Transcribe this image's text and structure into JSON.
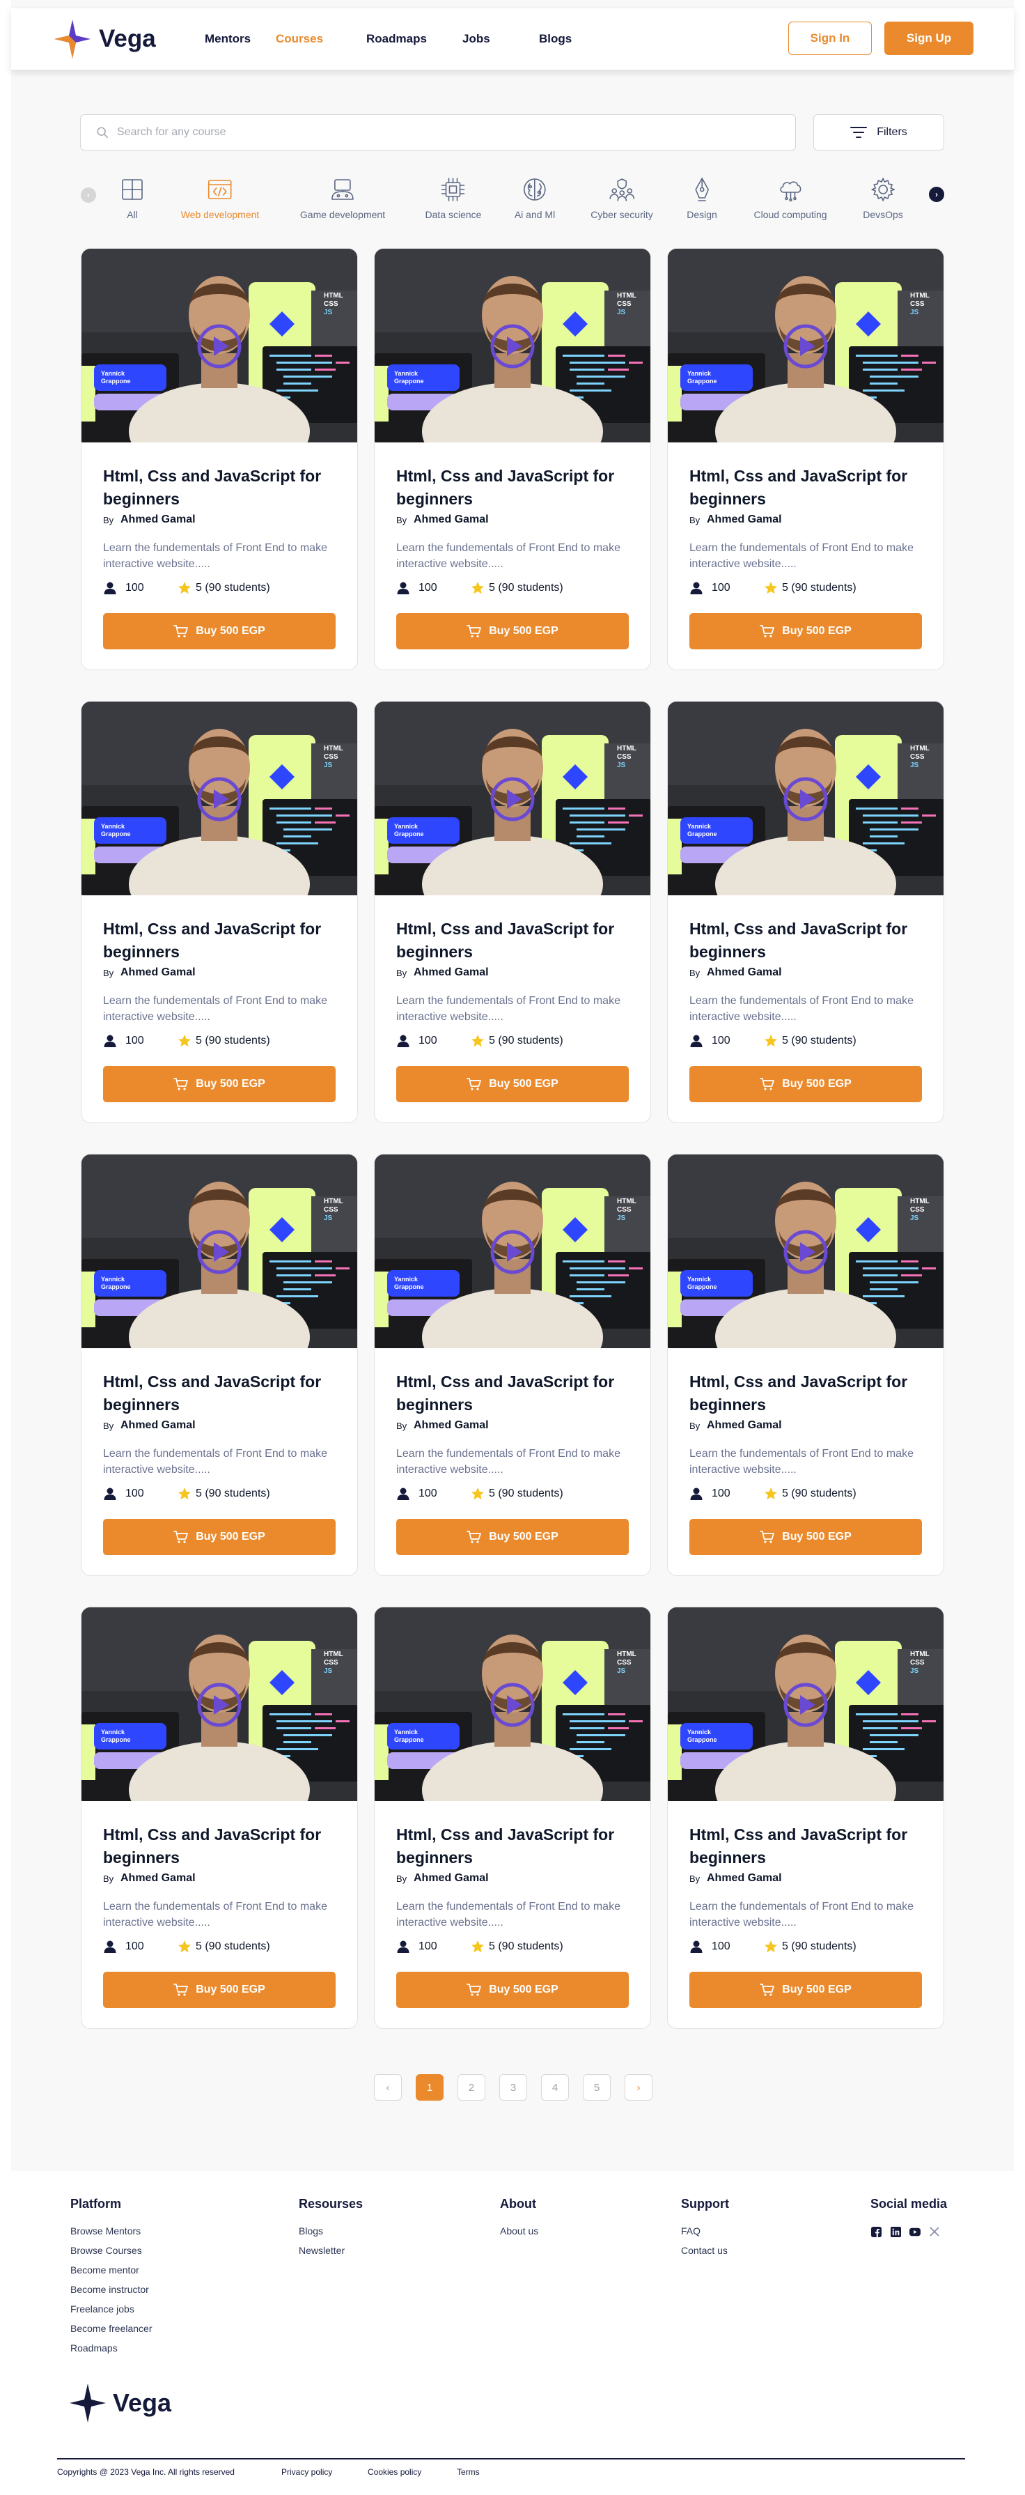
{
  "brand": {
    "name": "Vega",
    "colors": {
      "accent": "#ea8a2c",
      "navy": "#15193a",
      "purple": "#5b3cc4"
    }
  },
  "nav": {
    "links": [
      {
        "label": "Mentors",
        "active": false
      },
      {
        "label": "Courses",
        "active": true
      },
      {
        "label": "Roadmaps",
        "active": false
      },
      {
        "label": "Jobs",
        "active": false
      },
      {
        "label": "Blogs",
        "active": false
      }
    ],
    "signin_label": "Sign In",
    "signup_label": "Sign Up"
  },
  "search": {
    "placeholder": "Search for any course",
    "filters_label": "Filters"
  },
  "categories": [
    {
      "label": "All",
      "icon": "grid-icon",
      "active": false
    },
    {
      "label": "Web development",
      "icon": "browser-code-icon",
      "active": true
    },
    {
      "label": "Game development",
      "icon": "gamepad-icon",
      "active": false
    },
    {
      "label": "Data science",
      "icon": "chip-icon",
      "active": false
    },
    {
      "label": "Ai and Ml",
      "icon": "brain-icon",
      "active": false
    },
    {
      "label": "Cyber security",
      "icon": "team-shield-icon",
      "active": false
    },
    {
      "label": "Design",
      "icon": "pen-tool-icon",
      "active": false
    },
    {
      "label": "Cloud computing",
      "icon": "cloud-icon",
      "active": false
    },
    {
      "label": "DevsOps",
      "icon": "gear-icon",
      "active": false
    }
  ],
  "course_template": {
    "title": "Html, Css and JavaScript for beginners",
    "by": "By",
    "author": "Ahmed Gamal",
    "description": "Learn the fundementals of Front End to make interactive website.....",
    "students": "100",
    "rating": "5 (90 students)",
    "buy_label": "Buy 500 EGP",
    "thumb": {
      "badge_lines": [
        "HTML",
        "CSS",
        "JS"
      ],
      "chip_lines": [
        "Yannick",
        "Grappone"
      ]
    }
  },
  "course_count": 12,
  "pagination": {
    "prev": "‹",
    "pages": [
      "1",
      "2",
      "3",
      "4",
      "5"
    ],
    "current": "1",
    "next": "›"
  },
  "footer": {
    "platform": {
      "title": "Platform",
      "links": [
        "Browse Mentors",
        "Browse Courses",
        "Become mentor",
        "Become instructor",
        "Freelance jobs",
        "Become freelancer",
        "Roadmaps"
      ]
    },
    "resources": {
      "title": "Resourses",
      "links": [
        "Blogs",
        "Newsletter"
      ]
    },
    "about": {
      "title": "About",
      "links": [
        "About us"
      ]
    },
    "support": {
      "title": "Support",
      "links": [
        "FAQ",
        "Contact us"
      ]
    },
    "social": {
      "title": "Social media",
      "icons": [
        "facebook-icon",
        "linkedin-icon",
        "youtube-icon",
        "x-icon"
      ]
    },
    "copyright": "Copyrights @ 2023 Vega Inc. All rights reserved",
    "privacy": "Privacy policy",
    "cookies": "Cookies policy",
    "terms": "Terms"
  }
}
